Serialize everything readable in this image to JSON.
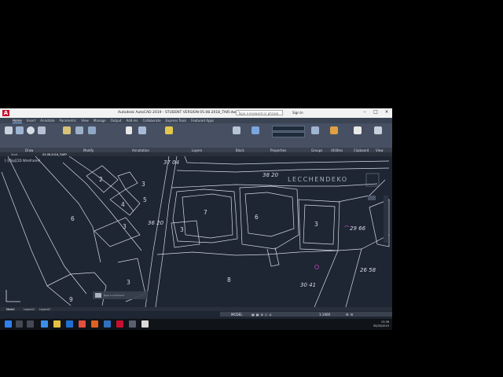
{
  "window": {
    "title": "Autodesk AutoCAD 2019 - STUDENT VERSION    05.08.2018_TAIR.dwg",
    "search_placeholder": "Type a keyword or phrase",
    "user": "Sign In"
  },
  "ribbon_tabs": [
    "Home",
    "Insert",
    "Annotate",
    "Parametric",
    "View",
    "Manage",
    "Output",
    "Add-ins",
    "Collaborate",
    "Express Tools",
    "Featured Apps"
  ],
  "ribbon_panels": [
    "Draw",
    "Modify",
    "Annotation",
    "Layers",
    "Block",
    "Properties",
    "Groups",
    "Utilities",
    "Clipboard",
    "View"
  ],
  "doc_tabs": [
    "Start",
    "05.08.2018_TAIR*"
  ],
  "viewport_label": "[-][Top][2D Wireframe]",
  "parcel_labels": {
    "l_3704": "37 04",
    "l_3820": "38 20",
    "l_3620": "36 20",
    "l_2966": "29 66",
    "l_2658": "26 58",
    "l_3041": "30 41",
    "owner": "LECCHENDEKO"
  },
  "lot_numbers": [
    "2",
    "3",
    "4",
    "5",
    "6",
    "3",
    "7",
    "6",
    "3",
    "3",
    "8",
    "9",
    "3"
  ],
  "layout_tabs": [
    "Model",
    "Layout1",
    "Layout2"
  ],
  "status": {
    "mode": "MODEL",
    "scale": "1:1000"
  },
  "clock": {
    "time": "13:36",
    "date": "05/05/2019"
  }
}
